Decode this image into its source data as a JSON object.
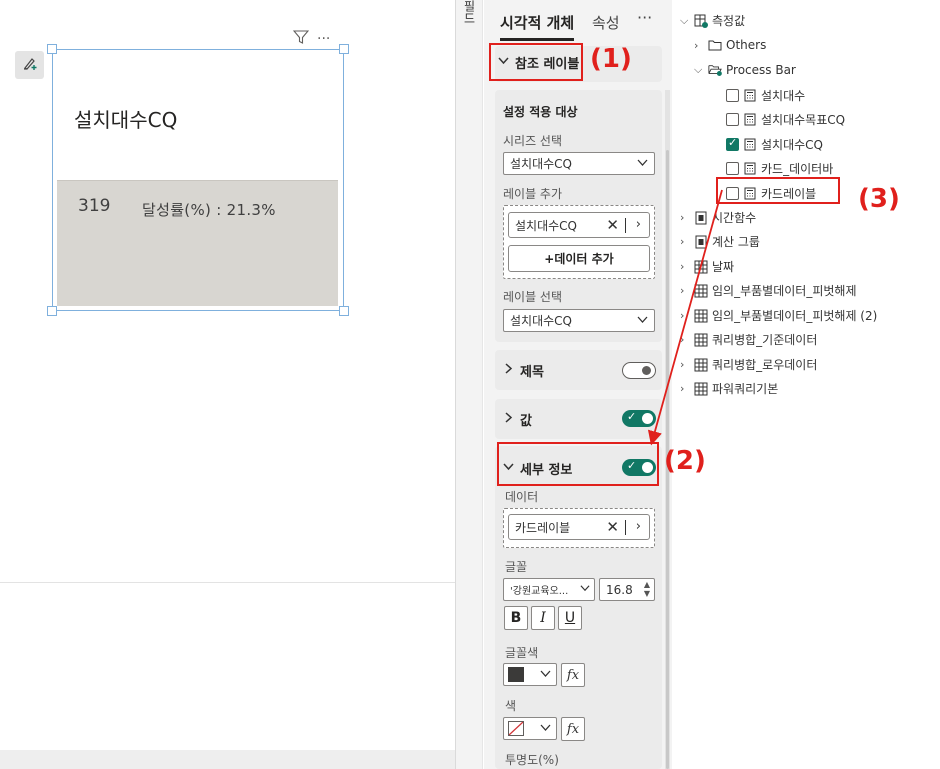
{
  "canvas": {
    "card_title": "설치대수CQ",
    "card_value": "319",
    "card_rate": "달성률(%) : 21.3%",
    "filter_icon": "filter-icon",
    "more_icon": "more-options-icon",
    "more_glyph": "···",
    "format_painter_icon": "format-painter-icon"
  },
  "divider": {
    "glyph": "필드"
  },
  "format_pane": {
    "tabs": [
      "시각적 개체",
      "속성"
    ],
    "more_glyph": "···",
    "reference_label": {
      "title": "참조 레이블",
      "apply_settings_title": "설정 적용 대상",
      "series_label": "시리즈 선택",
      "series_value": "설치대수CQ",
      "add_label": "레이블 추가",
      "add_chip": "설치대수CQ",
      "add_data_button": "+데이터 추가",
      "select_label": "레이블 선택",
      "select_value": "설치대수CQ"
    },
    "title_section": {
      "title": "제목",
      "toggle": "off"
    },
    "value_section": {
      "title": "값",
      "toggle": "on"
    },
    "detail_section": {
      "title": "세부 정보",
      "toggle": "on",
      "data_label": "데이터",
      "data_chip": "카드레이블",
      "font_label": "글꼴",
      "font_value": "'강원교육오...",
      "font_size": "16.8",
      "bold": "B",
      "italic": "I",
      "underline": "U",
      "font_color_label": "글꼴색",
      "font_color": "#3b3a39",
      "color_label": "색",
      "fx": "fx",
      "transparency_label": "투명도(%)"
    }
  },
  "data_pane": {
    "root": "측정값",
    "items": [
      {
        "label": "Others",
        "type": "folder"
      },
      {
        "label": "Process Bar",
        "type": "folder-open"
      },
      {
        "label": "설치대수",
        "type": "measure",
        "checked": false
      },
      {
        "label": "설치대수목표CQ",
        "type": "measure",
        "checked": false
      },
      {
        "label": "설치대수CQ",
        "type": "measure",
        "checked": true
      },
      {
        "label": "카드_데이터바",
        "type": "measure",
        "checked": false
      },
      {
        "label": "카드레이블",
        "type": "measure",
        "checked": false
      },
      {
        "label": "시간함수",
        "type": "calc-group"
      },
      {
        "label": "계산 그룹",
        "type": "calc-group"
      },
      {
        "label": "날짜",
        "type": "table"
      },
      {
        "label": "임의_부품별데이터_피벗해제",
        "type": "table"
      },
      {
        "label": "임의_부품별데이터_피벗해제 (2)",
        "type": "table"
      },
      {
        "label": "쿼리병합_기준데이터",
        "type": "table"
      },
      {
        "label": "쿼리병합_로우데이터",
        "type": "table"
      },
      {
        "label": "파워쿼리기본",
        "type": "table"
      }
    ]
  },
  "annotations": {
    "a1": "(1)",
    "a2": "(2)",
    "a3": "(3)",
    "color": "#e0201c"
  }
}
